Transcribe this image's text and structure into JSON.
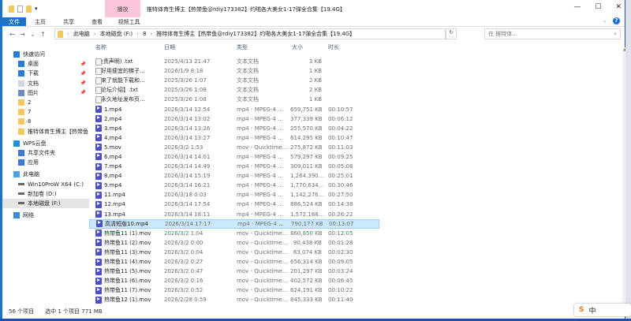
{
  "window": {
    "title": "推特体育生博主【热带鱼@rdiy173382】约啪各大美女1-17弹全合集【19.4G】",
    "controls": [
      "—",
      "☐",
      "✕"
    ]
  },
  "ribbon": {
    "context_group": "播放",
    "tabs": [
      "文件",
      "主页",
      "共享",
      "查看",
      "视频工具"
    ]
  },
  "address": {
    "crumbs": [
      "此电脑",
      "本地磁盘 (F:)",
      "8",
      "推特体育生博主【热带鱼@rdiy173382】约啪各大美女1-17弹全合集【19.4G】"
    ],
    "search_placeholder": "在 推特体..."
  },
  "sidebar": {
    "items": [
      {
        "label": "快速访问",
        "icon": "star-icon",
        "top": true
      },
      {
        "label": "桌面",
        "icon": "desktop-icon",
        "pinned": true
      },
      {
        "label": "下载",
        "icon": "download-icon",
        "pinned": true
      },
      {
        "label": "文档",
        "icon": "document-icon",
        "pinned": true
      },
      {
        "label": "图片",
        "icon": "pictures-icon",
        "pinned": true
      },
      {
        "label": "2",
        "icon": "folder-icon"
      },
      {
        "label": "7",
        "icon": "folder-icon"
      },
      {
        "label": "8",
        "icon": "folder-icon"
      },
      {
        "label": "推特体育生博主【热带鱼",
        "icon": "folder-icon"
      },
      {
        "label": "WPS云盘",
        "icon": "cloud-icon",
        "top": true
      },
      {
        "label": "共享文件夹",
        "icon": "share-icon"
      },
      {
        "label": "应用",
        "icon": "apps-icon"
      },
      {
        "label": "此电脑",
        "icon": "computer-icon",
        "top": true
      },
      {
        "label": "Win10ProW X64 (C:)",
        "icon": "drive-icon"
      },
      {
        "label": "新加卷 (D:)",
        "icon": "drive-icon"
      },
      {
        "label": "本地磁盘 (F:)",
        "icon": "drive-icon",
        "selected": true
      },
      {
        "label": "网络",
        "icon": "network-icon",
        "top": true
      }
    ]
  },
  "columns": [
    "名称",
    "日期",
    "类型",
    "大小",
    "时长"
  ],
  "files": [
    {
      "name": "(免责声明) .txt",
      "date": "2025/4/13 21:47",
      "type": "文本文档",
      "size": "3 KB",
      "dur": "",
      "kind": "txt"
    },
    {
      "name": "【好用便宜的梯子...",
      "date": "2026/1/9 8:18",
      "type": "文本文档",
      "size": "1 KB",
      "dur": "",
      "kind": "txt"
    },
    {
      "name": "【来了就能下载和...",
      "date": "2025/3/26 1:07",
      "type": "文本文档",
      "size": "2 KB",
      "dur": "",
      "kind": "txt"
    },
    {
      "name": "【论坛介绍】.txt",
      "date": "2025/3/26 1:08",
      "type": "文本文档",
      "size": "2 KB",
      "dur": "",
      "kind": "txt"
    },
    {
      "name": "【永久地址发布页...",
      "date": "2025/3/26 1:08",
      "type": "文本文档",
      "size": "1 KB",
      "dur": "",
      "kind": "txt"
    },
    {
      "name": "1.mp4",
      "date": "2026/3/14 12:54",
      "type": "mp4 - MPEG-4 ...",
      "size": "659,751 KB",
      "dur": "00:10:57",
      "kind": "vid"
    },
    {
      "name": "2.mp4",
      "date": "2026/3/14 13:02",
      "type": "mp4 - MPEG-4 ...",
      "size": "377,339 KB",
      "dur": "00:06:12",
      "kind": "vid"
    },
    {
      "name": "3.mp4",
      "date": "2026/3/14 13:26",
      "type": "mp4 - MPEG-4 ...",
      "size": "255,570 KB",
      "dur": "00:04:22",
      "kind": "vid"
    },
    {
      "name": "4.mp4",
      "date": "2026/3/14 13:27",
      "type": "mp4 - MPEG-4 ...",
      "size": "614,295 KB",
      "dur": "00:10:47",
      "kind": "vid"
    },
    {
      "name": "5.mov",
      "date": "2026/3/2 1:53",
      "type": "mov - Quicktime...",
      "size": "275,872 KB",
      "dur": "00:11:03",
      "kind": "vid"
    },
    {
      "name": "6.mp4",
      "date": "2026/3/14 14:01",
      "type": "mp4 - MPEG-4 ...",
      "size": "579,297 KB",
      "dur": "00:09:25",
      "kind": "vid"
    },
    {
      "name": "7.mp4",
      "date": "2026/3/14 14:49",
      "type": "mp4 - MPEG-4 ...",
      "size": "309,011 KB",
      "dur": "00:05:08",
      "kind": "vid"
    },
    {
      "name": "8.mp4",
      "date": "2026/3/14 15:19",
      "type": "mp4 - MPEG-4 ...",
      "size": "1,264,390...",
      "dur": "00:25:01",
      "kind": "vid"
    },
    {
      "name": "9.mp4",
      "date": "2026/3/14 16:21",
      "type": "mp4 - MPEG-4 ...",
      "size": "1,770,634...",
      "dur": "00:30:46",
      "kind": "vid"
    },
    {
      "name": "11.mp4",
      "date": "2026/3/18 0:03",
      "type": "mp4 - MPEG-4 ...",
      "size": "1,142,276...",
      "dur": "00:27:50",
      "kind": "vid"
    },
    {
      "name": "12.mp4",
      "date": "2026/3/14 17:54",
      "type": "mp4 - MPEG-4 ...",
      "size": "886,524 KB",
      "dur": "00:14:38",
      "kind": "vid"
    },
    {
      "name": "13.mp4",
      "date": "2026/3/14 18:11",
      "type": "mp4 - MPEG-4 ...",
      "size": "1,572,188...",
      "dur": "00:26:22",
      "kind": "vid"
    },
    {
      "name": "高清短版10.mp4",
      "date": "2026/3/14 17:17",
      "type": "mp4 - MPEG-4 ...",
      "size": "790,177 KB",
      "dur": "00:13:07",
      "kind": "vid",
      "selected": true
    },
    {
      "name": "热带鱼11 (1).mov",
      "date": "2026/3/2 1:04",
      "type": "mov - Quicktime...",
      "size": "860,850 KB",
      "dur": "00:12:05",
      "kind": "vid"
    },
    {
      "name": "热带鱼11 (2).mov",
      "date": "2026/3/2 0:00",
      "type": "mov - Quicktime...",
      "size": "90,438 KB",
      "dur": "00:01:28",
      "kind": "vid"
    },
    {
      "name": "热带鱼11 (3).mov",
      "date": "2026/3/2 0:04",
      "type": "mov - Quicktime...",
      "size": "63,074 KB",
      "dur": "00:02:30",
      "kind": "vid"
    },
    {
      "name": "热带鱼11 (4).mov",
      "date": "2026/3/2 0:27",
      "type": "mov - Quicktime...",
      "size": "656,314 KB",
      "dur": "00:09:05",
      "kind": "vid"
    },
    {
      "name": "热带鱼11 (5).mov",
      "date": "2026/3/2 0:47",
      "type": "mov - Quicktime...",
      "size": "201,297 KB",
      "dur": "00:03:24",
      "kind": "vid"
    },
    {
      "name": "热带鱼11 (6).mov",
      "date": "2026/3/2 0:16",
      "type": "mov - Quicktime...",
      "size": "402,572 KB",
      "dur": "00:06:45",
      "kind": "vid"
    },
    {
      "name": "热带鱼11 (7).mov",
      "date": "2026/3/2 0:52",
      "type": "mov - Quicktime...",
      "size": "624,191 KB",
      "dur": "00:10:22",
      "kind": "vid"
    },
    {
      "name": "热带鱼12 (1).mov",
      "date": "2026/2/28 0:59",
      "type": "mov - Quicktime...",
      "size": "845,333 KB",
      "dur": "00:11:40",
      "kind": "vid"
    }
  ],
  "status": {
    "count": "56 个项目",
    "selection": "选中 1 个项目  771 MB"
  },
  "ime": {
    "logo": "S",
    "mode": "中"
  }
}
